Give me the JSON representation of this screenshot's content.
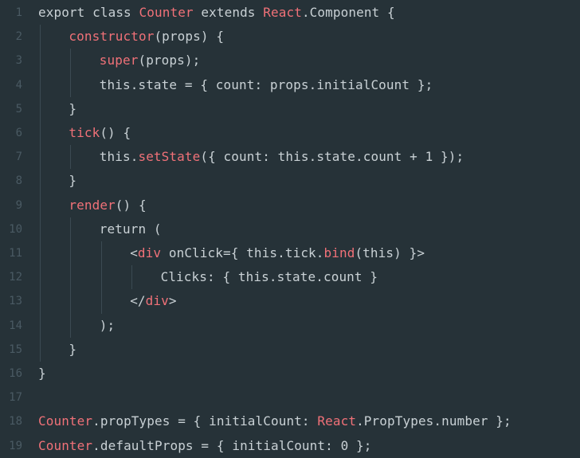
{
  "editor": {
    "colors": {
      "background": "#263238",
      "text": "#c9d1d5",
      "keyword": "#f07178",
      "line_number": "#4a5a63",
      "indent_guide": "#3b4a52"
    },
    "lines": [
      {
        "number": "1",
        "tokens": [
          {
            "t": "export class ",
            "c": "pl"
          },
          {
            "t": "Counter",
            "c": "kw"
          },
          {
            "t": " extends ",
            "c": "pl"
          },
          {
            "t": "React",
            "c": "kw"
          },
          {
            "t": ".Component {",
            "c": "pl"
          }
        ],
        "indent": 0
      },
      {
        "number": "2",
        "tokens": [
          {
            "t": "constructor",
            "c": "kw"
          },
          {
            "t": "(props) {",
            "c": "pl"
          }
        ],
        "indent": 1
      },
      {
        "number": "3",
        "tokens": [
          {
            "t": "super",
            "c": "kw"
          },
          {
            "t": "(props);",
            "c": "pl"
          }
        ],
        "indent": 2
      },
      {
        "number": "4",
        "tokens": [
          {
            "t": "this.state = { count: props.initialCount };",
            "c": "pl"
          }
        ],
        "indent": 2
      },
      {
        "number": "5",
        "tokens": [
          {
            "t": "}",
            "c": "pl"
          }
        ],
        "indent": 1
      },
      {
        "number": "6",
        "tokens": [
          {
            "t": "tick",
            "c": "kw"
          },
          {
            "t": "() {",
            "c": "pl"
          }
        ],
        "indent": 1
      },
      {
        "number": "7",
        "tokens": [
          {
            "t": "this.",
            "c": "pl"
          },
          {
            "t": "setState",
            "c": "kw"
          },
          {
            "t": "({ count: this.state.count + 1 });",
            "c": "pl"
          }
        ],
        "indent": 2
      },
      {
        "number": "8",
        "tokens": [
          {
            "t": "}",
            "c": "pl"
          }
        ],
        "indent": 1
      },
      {
        "number": "9",
        "tokens": [
          {
            "t": "render",
            "c": "kw"
          },
          {
            "t": "() {",
            "c": "pl"
          }
        ],
        "indent": 1
      },
      {
        "number": "10",
        "tokens": [
          {
            "t": "return (",
            "c": "pl"
          }
        ],
        "indent": 2
      },
      {
        "number": "11",
        "tokens": [
          {
            "t": "<",
            "c": "pl"
          },
          {
            "t": "div",
            "c": "kw"
          },
          {
            "t": " onClick={ this.tick.",
            "c": "pl"
          },
          {
            "t": "bind",
            "c": "kw"
          },
          {
            "t": "(this) }>",
            "c": "pl"
          }
        ],
        "indent": 3
      },
      {
        "number": "12",
        "tokens": [
          {
            "t": "Clicks: { this.state.count }",
            "c": "pl"
          }
        ],
        "indent": 4
      },
      {
        "number": "13",
        "tokens": [
          {
            "t": "</",
            "c": "pl"
          },
          {
            "t": "div",
            "c": "kw"
          },
          {
            "t": ">",
            "c": "pl"
          }
        ],
        "indent": 3
      },
      {
        "number": "14",
        "tokens": [
          {
            "t": ");",
            "c": "pl"
          }
        ],
        "indent": 2
      },
      {
        "number": "15",
        "tokens": [
          {
            "t": "}",
            "c": "pl"
          }
        ],
        "indent": 1
      },
      {
        "number": "16",
        "tokens": [
          {
            "t": "}",
            "c": "pl"
          }
        ],
        "indent": 0
      },
      {
        "number": "17",
        "tokens": [],
        "indent": 0
      },
      {
        "number": "18",
        "tokens": [
          {
            "t": "Counter",
            "c": "kw"
          },
          {
            "t": ".propTypes = { initialCount: ",
            "c": "pl"
          },
          {
            "t": "React",
            "c": "kw"
          },
          {
            "t": ".PropTypes.number };",
            "c": "pl"
          }
        ],
        "indent": 0
      },
      {
        "number": "19",
        "tokens": [
          {
            "t": "Counter",
            "c": "kw"
          },
          {
            "t": ".defaultProps = { initialCount: 0 };",
            "c": "pl"
          }
        ],
        "indent": 0
      }
    ]
  }
}
